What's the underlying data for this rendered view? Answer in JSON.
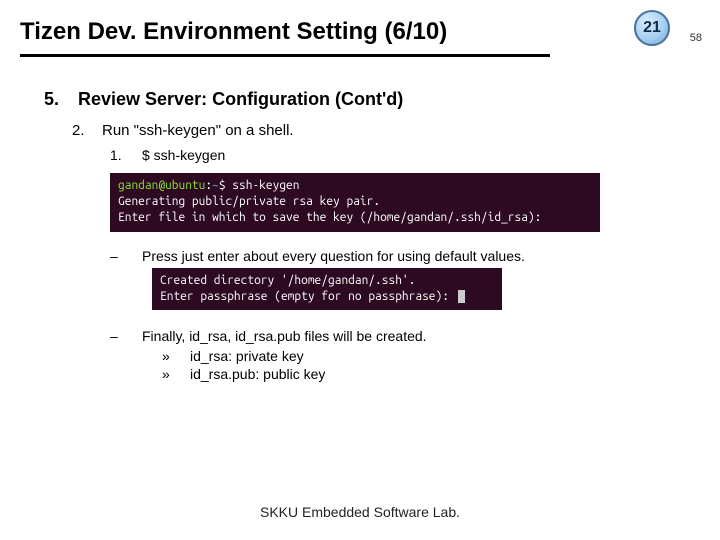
{
  "header": {
    "title": "Tizen Dev. Environment Setting (6/10)",
    "badge_number": "21",
    "small_page": "58"
  },
  "section": {
    "num": "5.",
    "title": "Review Server: Configuration (Cont'd)"
  },
  "step2": {
    "num": "2.",
    "text": "Run \"ssh-keygen\" on a shell."
  },
  "step2_1": {
    "num": "1.",
    "text": "$ ssh-keygen"
  },
  "terminal1": {
    "user": "gandan@ubuntu",
    "colon": ":",
    "path": "~",
    "dollar": "$",
    "cmd": " ssh-keygen",
    "line2": "Generating public/private rsa key pair.",
    "line3": "Enter file in which to save the key (/home/gandan/.ssh/id_rsa):"
  },
  "bullet1": {
    "dash": "–",
    "text": "Press just enter about every question for using default values."
  },
  "terminal2": {
    "line1": "Created directory '/home/gandan/.ssh'.",
    "line2": "Enter passphrase (empty for no passphrase): "
  },
  "bullet2": {
    "dash": "–",
    "text_a": "Finally, id_rsa, id_rsa.pub",
    "text_b": " files will be created."
  },
  "subitems": {
    "marker": "»",
    "row1_a": "id_rsa",
    "row1_b": ": private key",
    "row2_a": "id_rsa.pub",
    "row2_b": ": public key"
  },
  "footer": "SKKU Embedded Software Lab."
}
